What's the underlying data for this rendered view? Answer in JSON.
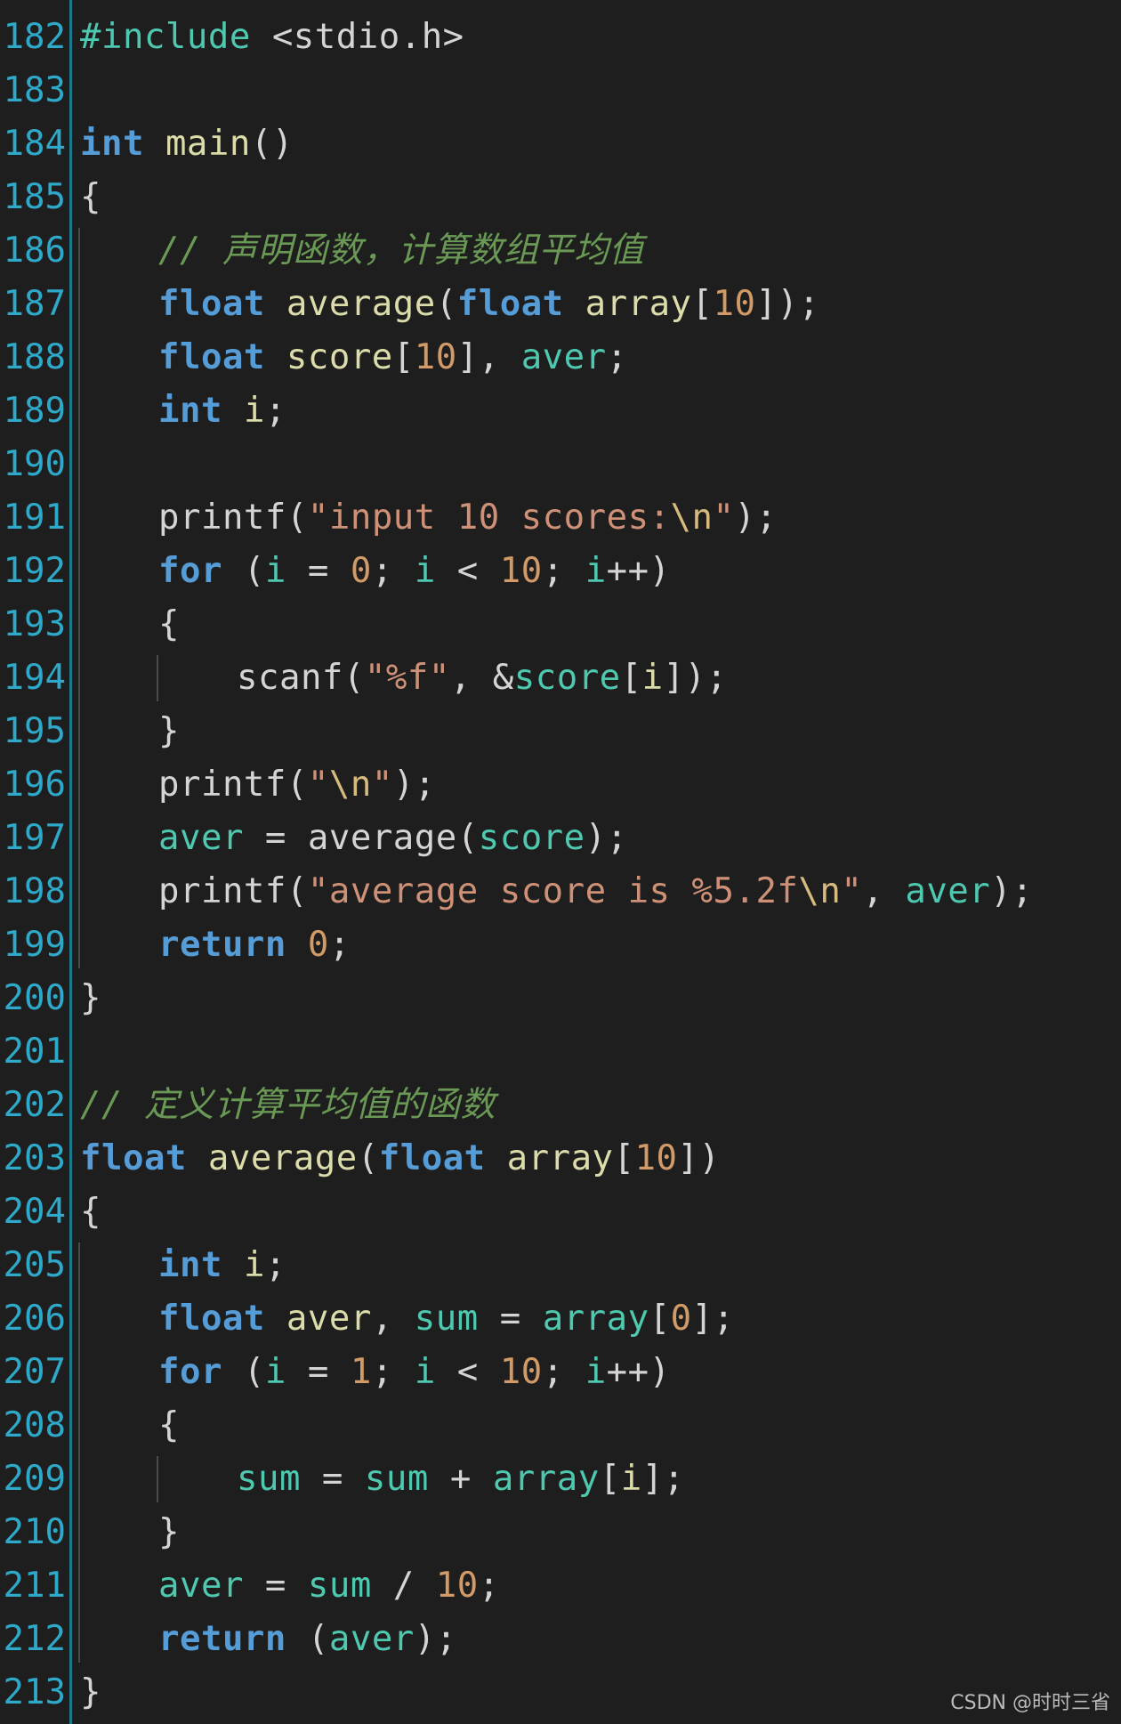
{
  "editor": {
    "lines": [
      {
        "num": "182",
        "tokens": [
          {
            "t": "#include ",
            "c": "pre"
          },
          {
            "t": "<stdio.h>",
            "c": "plain"
          }
        ],
        "indent": 0
      },
      {
        "num": "183",
        "tokens": [],
        "indent": 0
      },
      {
        "num": "184",
        "tokens": [
          {
            "t": "int",
            "c": "kw"
          },
          {
            "t": " ",
            "c": "plain"
          },
          {
            "t": "main",
            "c": "fn"
          },
          {
            "t": "()",
            "c": "plain"
          }
        ],
        "indent": 0
      },
      {
        "num": "185",
        "tokens": [
          {
            "t": "{",
            "c": "plain"
          }
        ],
        "indent": 0
      },
      {
        "num": "186",
        "tokens": [
          {
            "t": "// 声明函数，计算数组平均值",
            "c": "cmt"
          }
        ],
        "indent": 1
      },
      {
        "num": "187",
        "tokens": [
          {
            "t": "float",
            "c": "kw"
          },
          {
            "t": " ",
            "c": "plain"
          },
          {
            "t": "average",
            "c": "fn"
          },
          {
            "t": "(",
            "c": "plain"
          },
          {
            "t": "float",
            "c": "kw"
          },
          {
            "t": " ",
            "c": "plain"
          },
          {
            "t": "array",
            "c": "fn"
          },
          {
            "t": "[",
            "c": "plain"
          },
          {
            "t": "10",
            "c": "num"
          },
          {
            "t": "]);",
            "c": "plain"
          }
        ],
        "indent": 1
      },
      {
        "num": "188",
        "tokens": [
          {
            "t": "float",
            "c": "kw"
          },
          {
            "t": " ",
            "c": "plain"
          },
          {
            "t": "score",
            "c": "fn"
          },
          {
            "t": "[",
            "c": "plain"
          },
          {
            "t": "10",
            "c": "num"
          },
          {
            "t": "], ",
            "c": "plain"
          },
          {
            "t": "aver",
            "c": "var"
          },
          {
            "t": ";",
            "c": "plain"
          }
        ],
        "indent": 1
      },
      {
        "num": "189",
        "tokens": [
          {
            "t": "int",
            "c": "kw"
          },
          {
            "t": " ",
            "c": "plain"
          },
          {
            "t": "i",
            "c": "fn"
          },
          {
            "t": ";",
            "c": "plain"
          }
        ],
        "indent": 1
      },
      {
        "num": "190",
        "tokens": [],
        "indent": 1
      },
      {
        "num": "191",
        "tokens": [
          {
            "t": "printf",
            "c": "plain"
          },
          {
            "t": "(",
            "c": "plain"
          },
          {
            "t": "\"input 10 scores:",
            "c": "str"
          },
          {
            "t": "\\n",
            "c": "esc"
          },
          {
            "t": "\"",
            "c": "str"
          },
          {
            "t": ");",
            "c": "plain"
          }
        ],
        "indent": 1
      },
      {
        "num": "192",
        "tokens": [
          {
            "t": "for",
            "c": "kw"
          },
          {
            "t": " (",
            "c": "plain"
          },
          {
            "t": "i",
            "c": "var"
          },
          {
            "t": " = ",
            "c": "plain"
          },
          {
            "t": "0",
            "c": "num"
          },
          {
            "t": "; ",
            "c": "plain"
          },
          {
            "t": "i",
            "c": "var"
          },
          {
            "t": " < ",
            "c": "plain"
          },
          {
            "t": "10",
            "c": "num"
          },
          {
            "t": "; ",
            "c": "plain"
          },
          {
            "t": "i",
            "c": "var"
          },
          {
            "t": "++)",
            "c": "plain"
          }
        ],
        "indent": 1
      },
      {
        "num": "193",
        "tokens": [
          {
            "t": "{",
            "c": "plain"
          }
        ],
        "indent": 1
      },
      {
        "num": "194",
        "tokens": [
          {
            "t": "scanf",
            "c": "plain"
          },
          {
            "t": "(",
            "c": "plain"
          },
          {
            "t": "\"%f\"",
            "c": "str"
          },
          {
            "t": ", &",
            "c": "plain"
          },
          {
            "t": "score",
            "c": "var"
          },
          {
            "t": "[",
            "c": "plain"
          },
          {
            "t": "i",
            "c": "fn"
          },
          {
            "t": "]);",
            "c": "plain"
          }
        ],
        "indent": 2
      },
      {
        "num": "195",
        "tokens": [
          {
            "t": "}",
            "c": "plain"
          }
        ],
        "indent": 1
      },
      {
        "num": "196",
        "tokens": [
          {
            "t": "printf",
            "c": "plain"
          },
          {
            "t": "(",
            "c": "plain"
          },
          {
            "t": "\"",
            "c": "str"
          },
          {
            "t": "\\n",
            "c": "esc"
          },
          {
            "t": "\"",
            "c": "str"
          },
          {
            "t": ");",
            "c": "plain"
          }
        ],
        "indent": 1
      },
      {
        "num": "197",
        "tokens": [
          {
            "t": "aver",
            "c": "var"
          },
          {
            "t": " = ",
            "c": "plain"
          },
          {
            "t": "average",
            "c": "plain"
          },
          {
            "t": "(",
            "c": "plain"
          },
          {
            "t": "score",
            "c": "var"
          },
          {
            "t": ");",
            "c": "plain"
          }
        ],
        "indent": 1
      },
      {
        "num": "198",
        "tokens": [
          {
            "t": "printf",
            "c": "plain"
          },
          {
            "t": "(",
            "c": "plain"
          },
          {
            "t": "\"average score is %5.2f",
            "c": "str"
          },
          {
            "t": "\\n",
            "c": "esc"
          },
          {
            "t": "\"",
            "c": "str"
          },
          {
            "t": ", ",
            "c": "plain"
          },
          {
            "t": "aver",
            "c": "var"
          },
          {
            "t": ");",
            "c": "plain"
          }
        ],
        "indent": 1
      },
      {
        "num": "199",
        "tokens": [
          {
            "t": "return",
            "c": "kw"
          },
          {
            "t": " ",
            "c": "plain"
          },
          {
            "t": "0",
            "c": "num"
          },
          {
            "t": ";",
            "c": "plain"
          }
        ],
        "indent": 1
      },
      {
        "num": "200",
        "tokens": [
          {
            "t": "}",
            "c": "plain"
          }
        ],
        "indent": 0
      },
      {
        "num": "201",
        "tokens": [],
        "indent": 0
      },
      {
        "num": "202",
        "tokens": [
          {
            "t": "// 定义计算平均值的函数",
            "c": "cmt"
          }
        ],
        "indent": 0
      },
      {
        "num": "203",
        "tokens": [
          {
            "t": "float",
            "c": "kw"
          },
          {
            "t": " ",
            "c": "plain"
          },
          {
            "t": "average",
            "c": "fn"
          },
          {
            "t": "(",
            "c": "plain"
          },
          {
            "t": "float",
            "c": "kw"
          },
          {
            "t": " ",
            "c": "plain"
          },
          {
            "t": "array",
            "c": "fn"
          },
          {
            "t": "[",
            "c": "plain"
          },
          {
            "t": "10",
            "c": "num"
          },
          {
            "t": "])",
            "c": "plain"
          }
        ],
        "indent": 0
      },
      {
        "num": "204",
        "tokens": [
          {
            "t": "{",
            "c": "plain"
          }
        ],
        "indent": 0
      },
      {
        "num": "205",
        "tokens": [
          {
            "t": "int",
            "c": "kw"
          },
          {
            "t": " ",
            "c": "plain"
          },
          {
            "t": "i",
            "c": "fn"
          },
          {
            "t": ";",
            "c": "plain"
          }
        ],
        "indent": 1
      },
      {
        "num": "206",
        "tokens": [
          {
            "t": "float",
            "c": "kw"
          },
          {
            "t": " ",
            "c": "plain"
          },
          {
            "t": "aver",
            "c": "fn"
          },
          {
            "t": ", ",
            "c": "plain"
          },
          {
            "t": "sum",
            "c": "var"
          },
          {
            "t": " = ",
            "c": "plain"
          },
          {
            "t": "array",
            "c": "var"
          },
          {
            "t": "[",
            "c": "plain"
          },
          {
            "t": "0",
            "c": "num"
          },
          {
            "t": "];",
            "c": "plain"
          }
        ],
        "indent": 1
      },
      {
        "num": "207",
        "tokens": [
          {
            "t": "for",
            "c": "kw"
          },
          {
            "t": " (",
            "c": "plain"
          },
          {
            "t": "i",
            "c": "var"
          },
          {
            "t": " = ",
            "c": "plain"
          },
          {
            "t": "1",
            "c": "num"
          },
          {
            "t": "; ",
            "c": "plain"
          },
          {
            "t": "i",
            "c": "var"
          },
          {
            "t": " < ",
            "c": "plain"
          },
          {
            "t": "10",
            "c": "num"
          },
          {
            "t": "; ",
            "c": "plain"
          },
          {
            "t": "i",
            "c": "var"
          },
          {
            "t": "++)",
            "c": "plain"
          }
        ],
        "indent": 1
      },
      {
        "num": "208",
        "tokens": [
          {
            "t": "{",
            "c": "plain"
          }
        ],
        "indent": 1
      },
      {
        "num": "209",
        "tokens": [
          {
            "t": "sum",
            "c": "var"
          },
          {
            "t": " = ",
            "c": "plain"
          },
          {
            "t": "sum",
            "c": "var"
          },
          {
            "t": " + ",
            "c": "plain"
          },
          {
            "t": "array",
            "c": "var"
          },
          {
            "t": "[",
            "c": "plain"
          },
          {
            "t": "i",
            "c": "fn"
          },
          {
            "t": "];",
            "c": "plain"
          }
        ],
        "indent": 2
      },
      {
        "num": "210",
        "tokens": [
          {
            "t": "}",
            "c": "plain"
          }
        ],
        "indent": 1
      },
      {
        "num": "211",
        "tokens": [
          {
            "t": "aver",
            "c": "var"
          },
          {
            "t": " = ",
            "c": "plain"
          },
          {
            "t": "sum",
            "c": "var"
          },
          {
            "t": " / ",
            "c": "plain"
          },
          {
            "t": "10",
            "c": "num"
          },
          {
            "t": ";",
            "c": "plain"
          }
        ],
        "indent": 1
      },
      {
        "num": "212",
        "tokens": [
          {
            "t": "return",
            "c": "kw"
          },
          {
            "t": " (",
            "c": "plain"
          },
          {
            "t": "aver",
            "c": "var"
          },
          {
            "t": ");",
            "c": "plain"
          }
        ],
        "indent": 1
      },
      {
        "num": "213",
        "tokens": [
          {
            "t": "}",
            "c": "plain"
          }
        ],
        "indent": 0
      }
    ]
  },
  "watermark": "CSDN @时时三省",
  "colors": {
    "background": "#1e1e1e",
    "line_number": "#2ea9c9",
    "keyword": "#569cd6",
    "function": "#dcdcaa",
    "variable": "#4ec9b0",
    "number": "#d19a66",
    "string": "#ce9178",
    "comment": "#6a9955"
  }
}
